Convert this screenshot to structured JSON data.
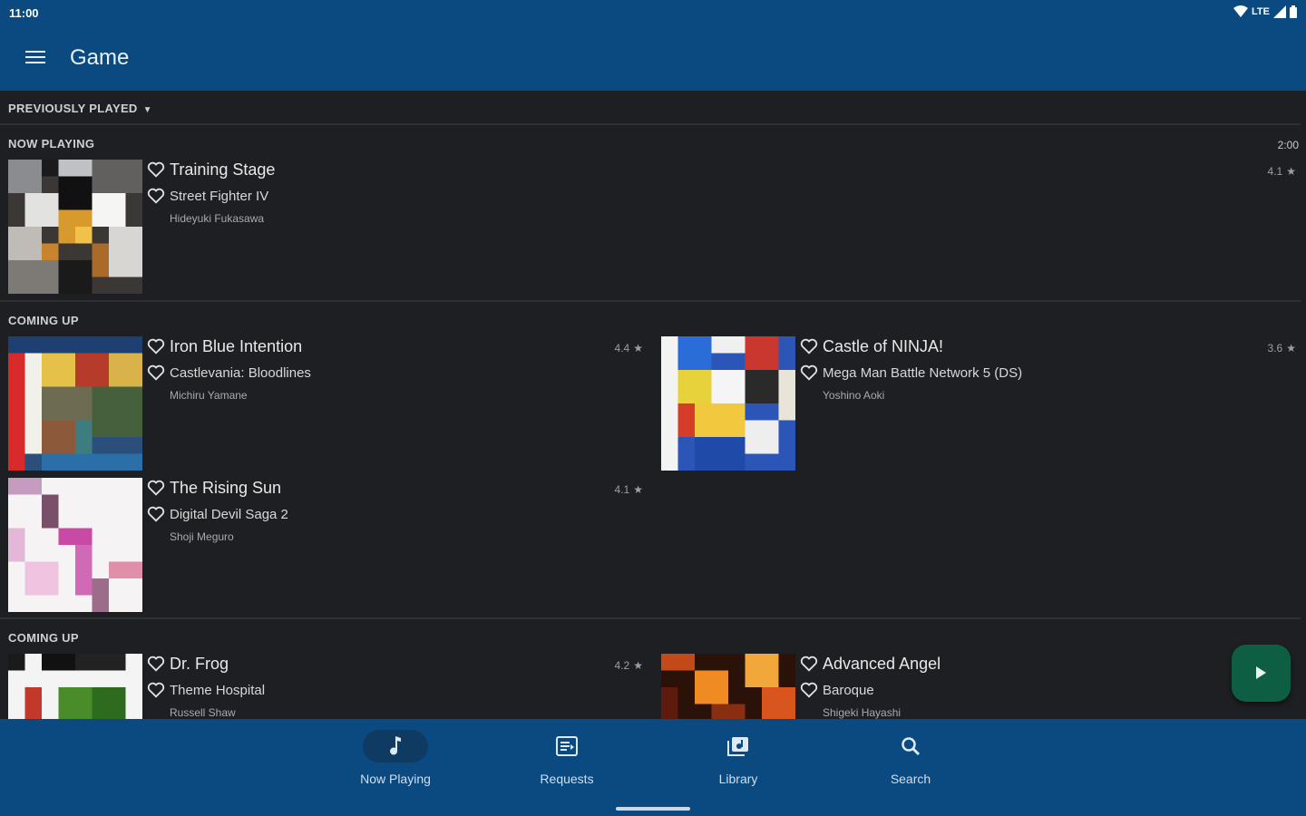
{
  "status_bar": {
    "time": "11:00",
    "network": "LTE"
  },
  "app_bar": {
    "title": "Game",
    "menu_icon": "hamburger-menu-icon"
  },
  "previously_played": {
    "label": "PREVIOUSLY PLAYED"
  },
  "now_playing": {
    "label": "NOW PLAYING",
    "duration": "2:00",
    "song": {
      "title": "Training Stage",
      "game": "Street Fighter IV",
      "artist": "Hideyuki Fukasawa",
      "rating": "4.1"
    }
  },
  "coming_up_1": {
    "label": "COMING UP",
    "songs": [
      {
        "title": "Iron Blue Intention",
        "game": "Castlevania: Bloodlines",
        "artist": "Michiru Yamane",
        "rating": "4.4"
      },
      {
        "title": "Castle of NINJA!",
        "game": "Mega Man Battle Network 5 (DS)",
        "artist": "Yoshino Aoki",
        "rating": "3.6"
      },
      {
        "title": "The Rising Sun",
        "game": "Digital Devil Saga 2",
        "artist": "Shoji Meguro",
        "rating": "4.1"
      }
    ]
  },
  "coming_up_2": {
    "label": "COMING UP",
    "songs": [
      {
        "title": "Dr. Frog",
        "game": "Theme Hospital",
        "artist": "Russell Shaw",
        "rating": "4.2"
      },
      {
        "title": "Advanced Angel",
        "game": "Baroque",
        "artist": "Shigeki Hayashi",
        "rating": ""
      }
    ]
  },
  "bottom_nav": {
    "items": [
      {
        "label": "Now Playing",
        "icon": "music-note-icon",
        "active": true
      },
      {
        "label": "Requests",
        "icon": "queue-list-icon",
        "active": false
      },
      {
        "label": "Library",
        "icon": "library-icon",
        "active": false
      },
      {
        "label": "Search",
        "icon": "search-icon",
        "active": false
      }
    ]
  },
  "colors": {
    "app_bar": "#0a4a80",
    "background": "#1e1f22",
    "fab": "#0d5e42"
  }
}
